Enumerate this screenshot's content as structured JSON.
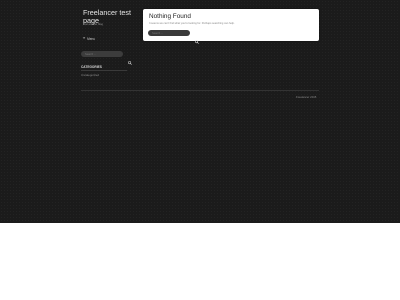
{
  "site": {
    "title": "Freelancer test page",
    "description": "Just another blog"
  },
  "menu": {
    "icon": "menu-icon",
    "label": "Menu"
  },
  "sidebar": {
    "search": {
      "placeholder": "Search ...",
      "icon": "search-icon"
    },
    "categories": {
      "title": "CATEGORIES",
      "items": [
        {
          "label": "Uncategorized"
        }
      ]
    }
  },
  "content": {
    "title": "Nothing Found",
    "message": "It seems we can't find what you're looking for. Perhaps searching can help.",
    "search": {
      "placeholder": "Search ...",
      "icon": "search-icon"
    }
  },
  "footer": {
    "text": "Freelancer 2015"
  },
  "colors": {
    "background": "#1b1b1b",
    "card": "#ffffff",
    "search_field": "#3a3a3a"
  }
}
